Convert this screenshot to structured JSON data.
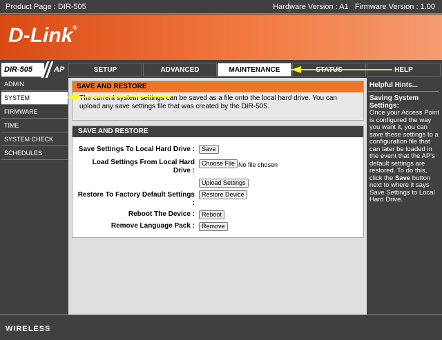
{
  "topbar": {
    "product": "Product Page : DIR-505",
    "hardware": "Hardware Version : A1",
    "firmware": "Firmware Version : 1.00"
  },
  "brand": {
    "logo": "D-Link",
    "reg": "®"
  },
  "model": {
    "name": "DIR-505",
    "mode": "AP"
  },
  "tabs": [
    {
      "label": "SETUP"
    },
    {
      "label": "ADVANCED"
    },
    {
      "label": "MAINTENANCE"
    },
    {
      "label": "STATUS"
    },
    {
      "label": "HELP"
    }
  ],
  "sidebar": {
    "items": [
      {
        "label": "ADMIN"
      },
      {
        "label": "SYSTEM"
      },
      {
        "label": "FIRMWARE"
      },
      {
        "label": "TIME"
      },
      {
        "label": "SYSTEM CHECK"
      },
      {
        "label": "SCHEDULES"
      }
    ]
  },
  "intro": {
    "title": "SAVE AND RESTORE",
    "text": "The current system settings can be saved as a file onto the local hard drive. You can upload any save settings file that was created by the DIR-505."
  },
  "form": {
    "title": "SAVE AND RESTORE",
    "save_label": "Save Settings To Local Hard Drive :",
    "save_button": "Save",
    "load_label": "Load Settings From Local Hard Drive :",
    "choose_button": "Choose File",
    "no_file": "No file chosen",
    "upload_button": "Upload Settings",
    "restore_label": "Restore To Factory Default Settings :",
    "restore_button": "Restore Device",
    "reboot_label": "Reboot The Device :",
    "reboot_button": "Reboot",
    "language_label": "Remove Language Pack :",
    "language_button": "Remove"
  },
  "hints": {
    "title": "Helpful Hints...",
    "subtitle": "Saving System Settings:",
    "body_pre": "Once your Access Point is configured the way you want it, you can save these settings to a configuration file that can later be loaded in the event that the AP's default settings are restored. To do this, click the ",
    "body_bold": "Save",
    "body_post": " button next to where it says Save Settings to Local Hard Drive."
  },
  "footer": {
    "label": "WIRELESS"
  },
  "colors": {
    "accent": "#f07526",
    "dark": "#404040",
    "arrow": "#ffff00"
  }
}
